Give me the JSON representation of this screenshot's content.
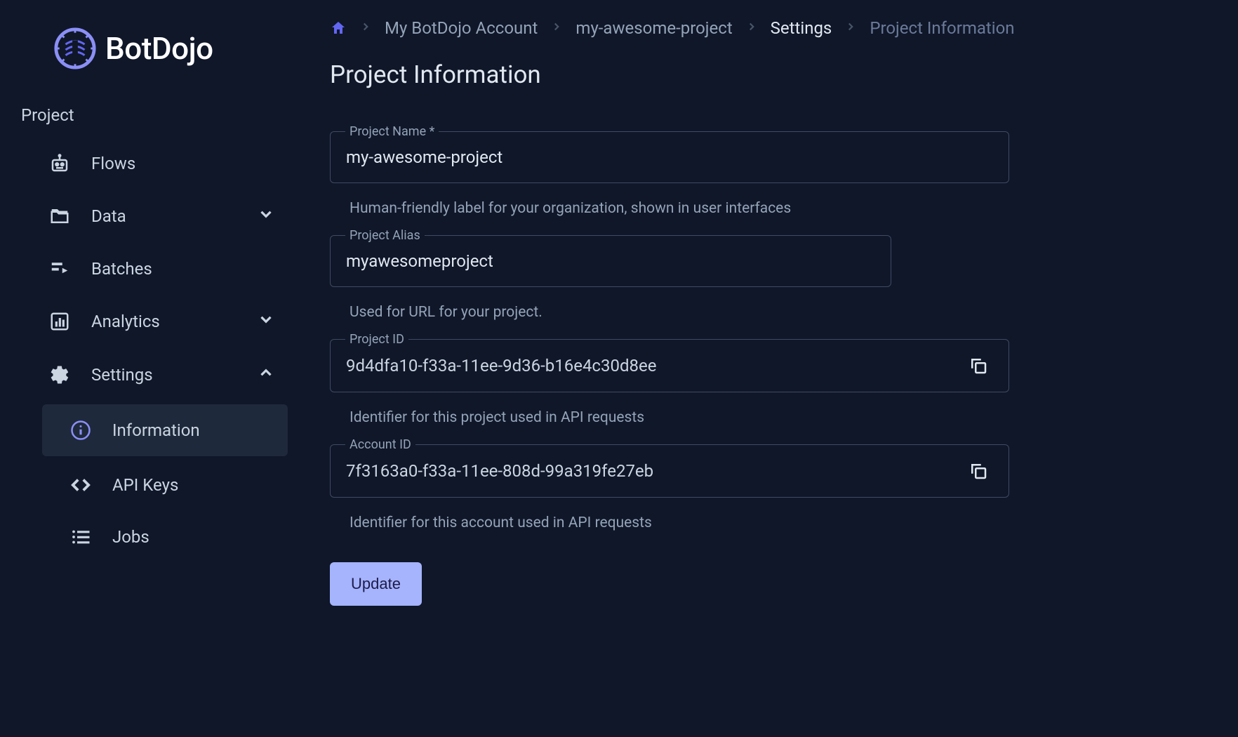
{
  "brand": {
    "name": "BotDojo"
  },
  "sidebar": {
    "section_label": "Project",
    "items": {
      "flows": "Flows",
      "data": "Data",
      "batches": "Batches",
      "analytics": "Analytics",
      "settings": "Settings"
    },
    "settings_sub": {
      "information": "Information",
      "api_keys": "API Keys",
      "jobs": "Jobs"
    }
  },
  "breadcrumb": {
    "account": "My BotDojo Account",
    "project": "my-awesome-project",
    "settings": "Settings",
    "current": "Project Information"
  },
  "page": {
    "title": "Project Information"
  },
  "form": {
    "project_name": {
      "label": "Project Name *",
      "value": "my-awesome-project",
      "help": "Human-friendly label for your organization, shown in user interfaces"
    },
    "project_alias": {
      "label": "Project Alias",
      "value": "myawesomeproject",
      "help": "Used for URL for your project."
    },
    "project_id": {
      "label": "Project ID",
      "value": "9d4dfa10-f33a-11ee-9d36-b16e4c30d8ee",
      "help": "Identifier for this project used in API requests"
    },
    "account_id": {
      "label": "Account ID",
      "value": "7f3163a0-f33a-11ee-808d-99a319fe27eb",
      "help": "Identifier for this account used in API requests"
    },
    "update_button": "Update"
  }
}
